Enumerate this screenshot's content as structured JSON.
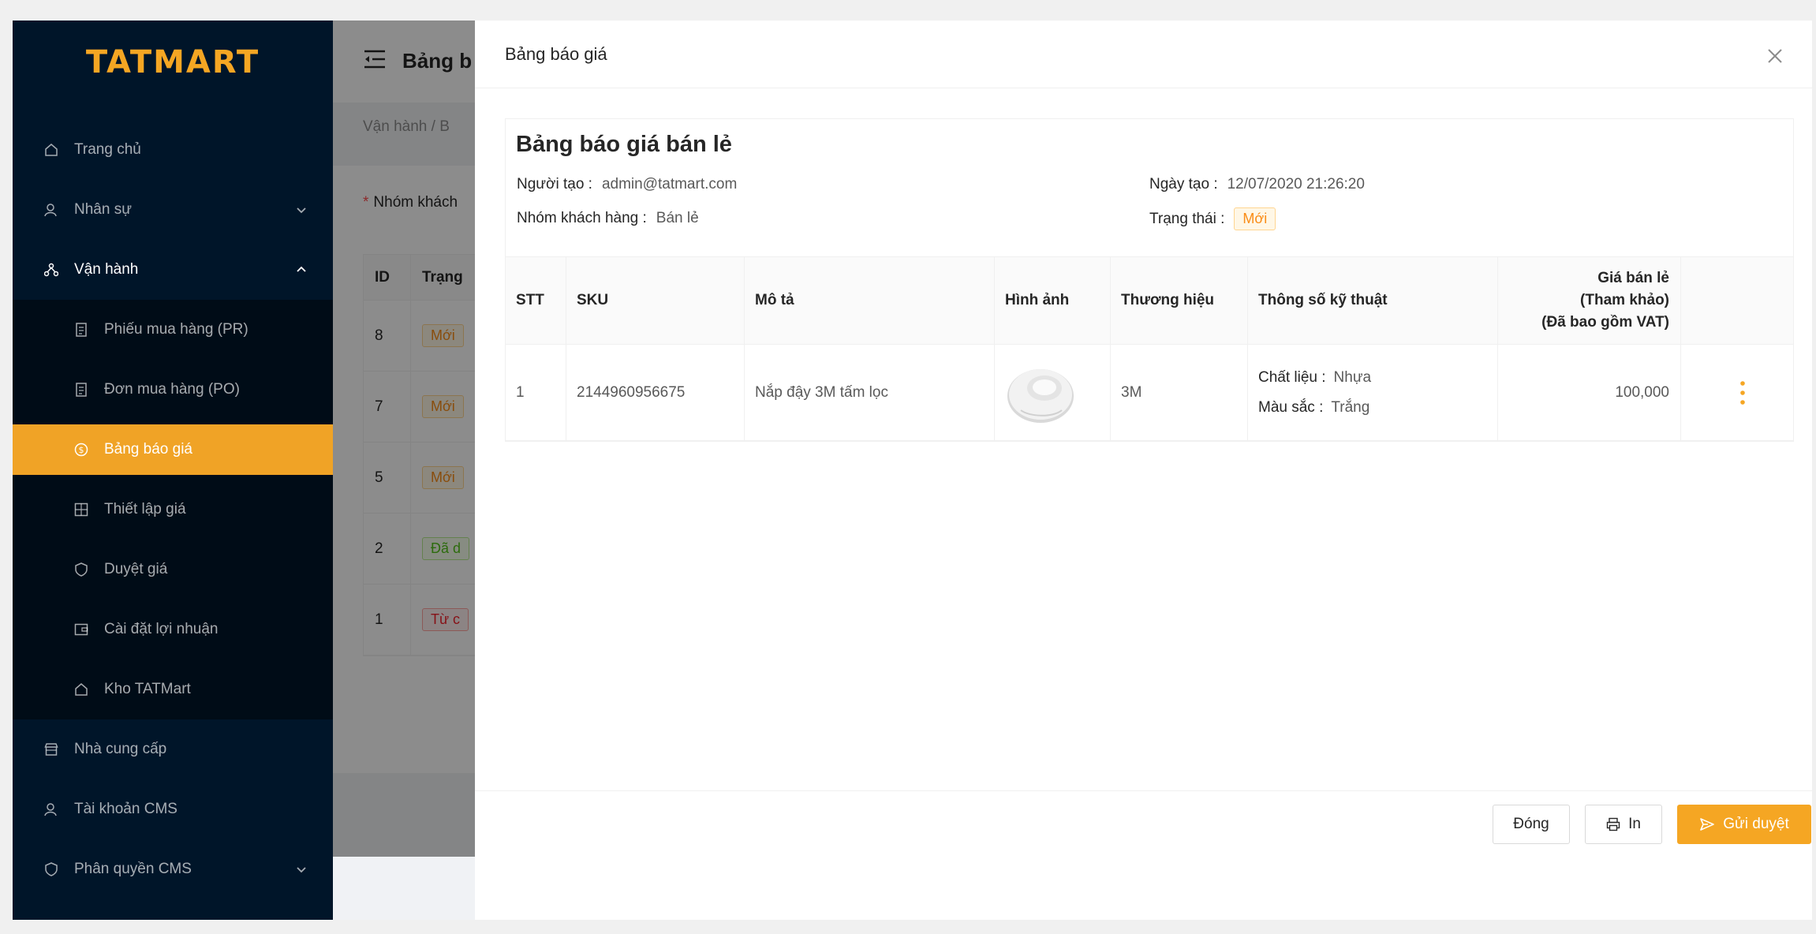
{
  "brand": {
    "logo": "TATMART",
    "accent": "#f5a623"
  },
  "sidebar": {
    "items": [
      {
        "label": "Trang chủ",
        "icon": "home-icon"
      },
      {
        "label": "Nhân sự",
        "icon": "user-icon"
      },
      {
        "label": "Vận hành",
        "icon": "workflow-icon"
      },
      {
        "label": "Phiếu mua hàng (PR)",
        "icon": "document-icon"
      },
      {
        "label": "Đơn mua hàng (PO)",
        "icon": "document-icon"
      },
      {
        "label": "Bảng báo giá",
        "icon": "dollar-icon"
      },
      {
        "label": "Thiết lập giá",
        "icon": "calculator-icon"
      },
      {
        "label": "Duyệt giá",
        "icon": "shield-icon"
      },
      {
        "label": "Cài đặt lợi nhuận",
        "icon": "wallet-icon"
      },
      {
        "label": "Kho TATMart",
        "icon": "home-icon"
      },
      {
        "label": "Nhà cung cấp",
        "icon": "shop-icon"
      },
      {
        "label": "Tài khoản CMS",
        "icon": "user-icon"
      },
      {
        "label": "Phân quyền CMS",
        "icon": "shield-icon"
      }
    ]
  },
  "page": {
    "title": "Bảng b",
    "breadcrumb": "Vận hành  /  B",
    "filter_label": "Nhóm khách",
    "table": {
      "headers": [
        "ID",
        "Trạng"
      ],
      "rows": [
        {
          "id": "8",
          "status": "Mới",
          "kind": "new"
        },
        {
          "id": "7",
          "status": "Mới",
          "kind": "new"
        },
        {
          "id": "5",
          "status": "Mới",
          "kind": "new"
        },
        {
          "id": "2",
          "status": "Đã d",
          "kind": "ok"
        },
        {
          "id": "1",
          "status": "Từ c",
          "kind": "rej"
        }
      ]
    }
  },
  "modal": {
    "title": "Bảng báo giá",
    "quote_title": "Bảng báo giá bán lẻ",
    "creator_label": "Người tạo :",
    "creator": "admin@tatmart.com",
    "group_label": "Nhóm khách hàng :",
    "group": "Bán lẻ",
    "date_label": "Ngày tạo :",
    "date": "12/07/2020 21:26:20",
    "status_label": "Trạng thái :",
    "status": "Mới",
    "headers": {
      "stt": "STT",
      "sku": "SKU",
      "desc": "Mô tả",
      "image": "Hình ảnh",
      "brand": "Thương hiệu",
      "spec": "Thông số kỹ thuật",
      "price_line1": "Giá bán lẻ",
      "price_line2": "(Tham khảo)",
      "price_line3": "(Đã bao gồm VAT)"
    },
    "rows": [
      {
        "stt": "1",
        "sku": "2144960956675",
        "desc": "Nắp đậy 3M tấm lọc",
        "brand": "3M",
        "spec_material_label": "Chất liệu :",
        "spec_material": "Nhựa",
        "spec_color_label": "Màu sắc :",
        "spec_color": "Trắng",
        "price": "100,000"
      }
    ],
    "buttons": {
      "close": "Đóng",
      "print": "In",
      "submit": "Gửi duyệt"
    }
  }
}
